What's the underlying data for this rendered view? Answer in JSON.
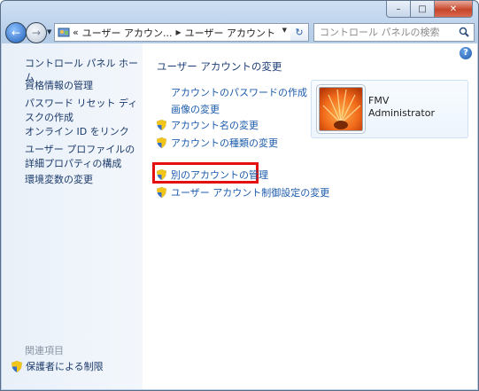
{
  "window": {
    "minimize_glyph": "–",
    "maximize_glyph": "□",
    "close_glyph": "✕"
  },
  "navigation": {
    "back_glyph": "←",
    "forward_glyph": "→",
    "breadcrumbs": [
      "«",
      "ユーザー アカウン...",
      "ユーザー アカウント"
    ],
    "refresh_glyph": "↻",
    "search_placeholder": "コントロール パネルの検索"
  },
  "sidebar": {
    "home": "コントロール パネル ホーム",
    "links": [
      "資格情報の管理",
      "パスワード リセット ディスクの作成",
      "オンライン ID をリンク",
      "ユーザー プロファイルの詳細プロパティの構成",
      "環境変数の変更"
    ],
    "related_heading": "関連項目",
    "parental_controls": "保護者による制限"
  },
  "main": {
    "help_glyph": "?",
    "title": "ユーザー アカウントの変更",
    "tasks": [
      "アカウントのパスワードの作成",
      "画像の変更",
      "アカウント名の変更",
      "アカウントの種類の変更"
    ],
    "manage_other": "別のアカウントの管理",
    "uac_settings": "ユーザー アカウント制御設定の変更",
    "highlight_color": "#e41010"
  },
  "user": {
    "name": "FMV",
    "role": "Administrator"
  },
  "icons": [
    "shield-icon",
    "search-icon",
    "help-icon",
    "control-panel-icon",
    "flower-avatar"
  ]
}
